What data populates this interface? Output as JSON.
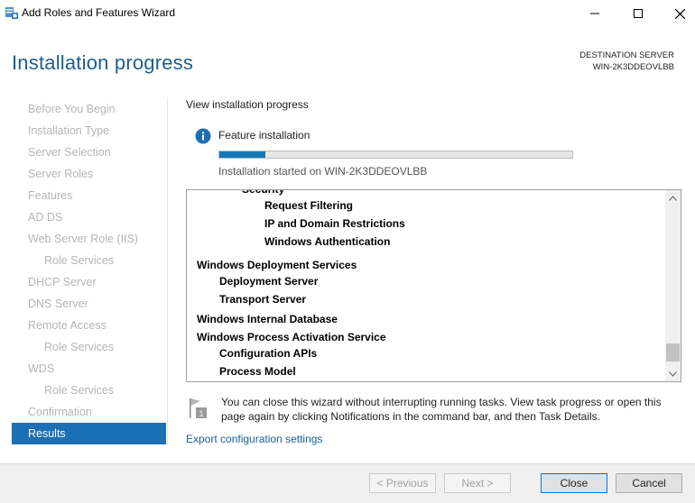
{
  "window": {
    "title": "Add Roles and Features Wizard"
  },
  "header": {
    "page_title": "Installation progress",
    "destination_label": "DESTINATION SERVER",
    "destination_server": "WIN-2K3DDEOVLBB"
  },
  "sidebar": {
    "items": [
      {
        "label": "Before You Begin",
        "sub": false,
        "active": false
      },
      {
        "label": "Installation Type",
        "sub": false,
        "active": false
      },
      {
        "label": "Server Selection",
        "sub": false,
        "active": false
      },
      {
        "label": "Server Roles",
        "sub": false,
        "active": false
      },
      {
        "label": "Features",
        "sub": false,
        "active": false
      },
      {
        "label": "AD DS",
        "sub": false,
        "active": false
      },
      {
        "label": "Web Server Role (IIS)",
        "sub": false,
        "active": false
      },
      {
        "label": "Role Services",
        "sub": true,
        "active": false
      },
      {
        "label": "DHCP Server",
        "sub": false,
        "active": false
      },
      {
        "label": "DNS Server",
        "sub": false,
        "active": false
      },
      {
        "label": "Remote Access",
        "sub": false,
        "active": false
      },
      {
        "label": "Role Services",
        "sub": true,
        "active": false
      },
      {
        "label": "WDS",
        "sub": false,
        "active": false
      },
      {
        "label": "Role Services",
        "sub": true,
        "active": false
      },
      {
        "label": "Confirmation",
        "sub": false,
        "active": false
      },
      {
        "label": "Results",
        "sub": false,
        "active": true
      }
    ]
  },
  "main": {
    "view_label": "View installation progress",
    "feature_label": "Feature installation",
    "progress_fraction": 0.13,
    "started_text": "Installation started on WIN-2K3DDEOVLBB",
    "list_items": [
      {
        "text": "Security",
        "level": 2
      },
      {
        "text": "Request Filtering",
        "level": 3
      },
      {
        "text": "IP and Domain Restrictions",
        "level": 3
      },
      {
        "text": "Windows Authentication",
        "level": 3
      },
      {
        "text": "Windows Deployment Services",
        "level": 0
      },
      {
        "text": "Deployment Server",
        "level": 1
      },
      {
        "text": "Transport Server",
        "level": 1
      },
      {
        "text": "Windows Internal Database",
        "level": 0
      },
      {
        "text": "Windows Process Activation Service",
        "level": 0
      },
      {
        "text": "Configuration APIs",
        "level": 1
      },
      {
        "text": "Process Model",
        "level": 1
      }
    ],
    "note": "You can close this wizard without interrupting running tasks. View task progress or open this page again by clicking Notifications in the command bar, and then Task Details.",
    "note_icon_badge": "1",
    "export_link": "Export configuration settings"
  },
  "footer": {
    "previous_label": "< Previous",
    "next_label": "Next >",
    "close_label": "Close",
    "cancel_label": "Cancel"
  },
  "colors": {
    "title_accent": "#1e5d8c",
    "active_nav": "#1b6fb5",
    "progress_fill": "#157bb8",
    "link": "#1a5e9a"
  }
}
